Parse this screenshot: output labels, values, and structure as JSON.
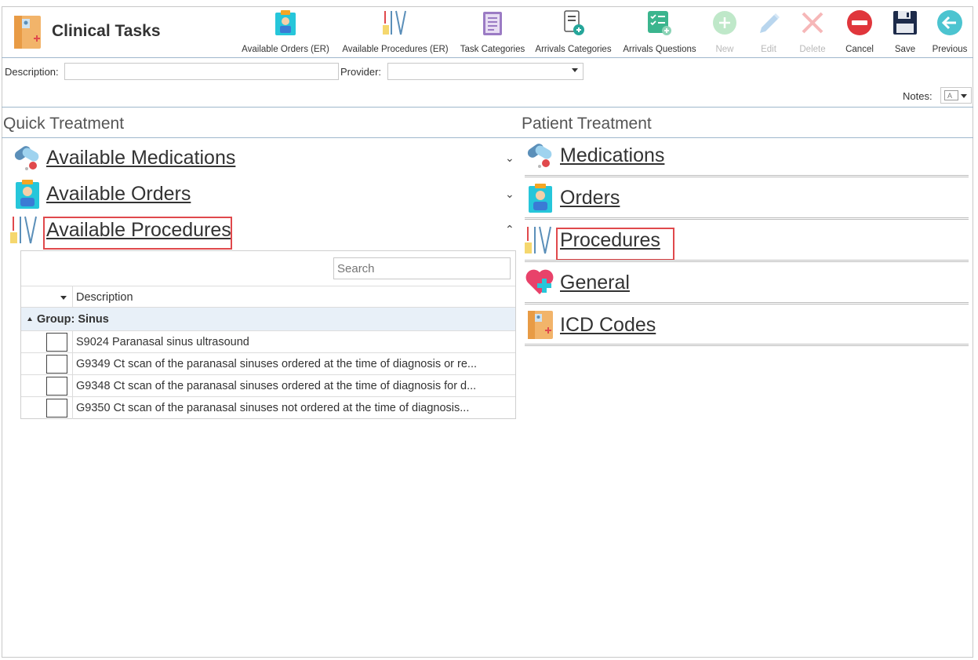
{
  "app": {
    "title": "Clinical Tasks"
  },
  "toolbar": [
    {
      "label": "Available Orders (ER)",
      "icon": "clipboard-doctor-icon",
      "enabled": true
    },
    {
      "label": "Available Procedures (ER)",
      "icon": "surgical-tools-icon",
      "enabled": true
    },
    {
      "label": "Task Categories",
      "icon": "task-list-icon",
      "enabled": true
    },
    {
      "label": "Arrivals Categories",
      "icon": "document-add-icon",
      "enabled": true
    },
    {
      "label": "Arrivals Questions",
      "icon": "checklist-add-icon",
      "enabled": true
    },
    {
      "label": "New",
      "icon": "plus-circle-icon",
      "enabled": false
    },
    {
      "label": "Edit",
      "icon": "pencil-icon",
      "enabled": false
    },
    {
      "label": "Delete",
      "icon": "x-icon",
      "enabled": false
    },
    {
      "label": "Cancel",
      "icon": "no-entry-icon",
      "enabled": true
    },
    {
      "label": "Save",
      "icon": "floppy-disk-icon",
      "enabled": true
    },
    {
      "label": "Previous",
      "icon": "arrow-left-circle-icon",
      "enabled": true
    }
  ],
  "filters": {
    "description_label": "Description:",
    "description_value": "",
    "provider_label": "Provider:",
    "provider_value": "",
    "notes_label": "Notes:"
  },
  "quick_treatment": {
    "title": "Quick Treatment",
    "items": [
      {
        "label": "Available Medications",
        "icon": "pills-icon",
        "expanded": false
      },
      {
        "label": "Available Orders",
        "icon": "clipboard-doctor-icon",
        "expanded": false
      },
      {
        "label": "Available Procedures",
        "icon": "surgical-tools-icon",
        "expanded": true
      }
    ],
    "grid": {
      "search_placeholder": "Search",
      "column_description": "Description",
      "group_label": "Group: Sinus",
      "rows": [
        "S9024 Paranasal sinus ultrasound",
        "G9349 Ct scan of the paranasal sinuses ordered at the time of diagnosis or re...",
        "G9348 Ct scan of the paranasal sinuses ordered at the time of diagnosis for d...",
        "G9350 Ct scan of the paranasal sinuses not ordered at the time of diagnosis..."
      ]
    }
  },
  "patient_treatment": {
    "title": "Patient Treatment",
    "items": [
      {
        "label": "Medications",
        "icon": "pills-icon"
      },
      {
        "label": "Orders",
        "icon": "clipboard-doctor-icon"
      },
      {
        "label": "Procedures",
        "icon": "surgical-tools-icon"
      },
      {
        "label": "General",
        "icon": "heart-plus-icon"
      },
      {
        "label": "ICD Codes",
        "icon": "medical-folder-icon"
      }
    ]
  },
  "colors": {
    "highlight": "#e0494c",
    "group_bg": "#e8f0f8",
    "divider": "#9fb7cc"
  }
}
